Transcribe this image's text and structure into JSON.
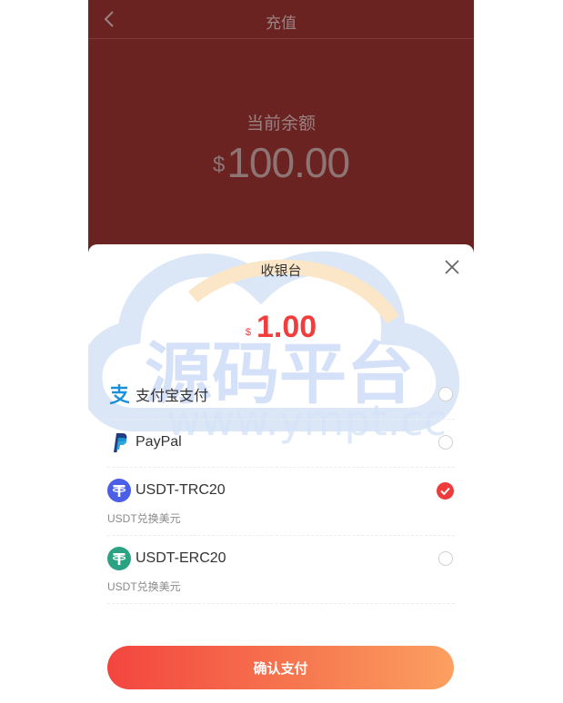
{
  "header": {
    "title": "充值",
    "back_icon": "chevron-left-icon"
  },
  "balance": {
    "label": "当前余额",
    "currency": "$",
    "amount": "100.00"
  },
  "cashier": {
    "title": "收银台",
    "close_icon": "close-icon",
    "currency": "$",
    "amount": "1.00",
    "methods": [
      {
        "label": "支付宝支付",
        "sub": "",
        "icon": "alipay-icon",
        "selected": false
      },
      {
        "label": "PayPal",
        "sub": "",
        "icon": "paypal-icon",
        "selected": false
      },
      {
        "label": "USDT-TRC20",
        "sub": "USDT兑换美元",
        "icon": "tether-icon",
        "selected": true
      },
      {
        "label": "USDT-ERC20",
        "sub": "USDT兑换美元",
        "icon": "tether-icon",
        "selected": false
      }
    ],
    "confirm_label": "确认支付"
  },
  "watermark": {
    "title": "源码平台",
    "url": "www.ympt.cc"
  },
  "colors": {
    "header_bg": "#6b2322",
    "accent": "#ee3b3b",
    "button_gradient_start": "#f3453f",
    "button_gradient_end": "#fca061",
    "tether_trc": "#4a5ee8",
    "tether_erc": "#2aa283",
    "alipay": "#1a8fdc",
    "paypal_dark": "#253b80",
    "paypal_light": "#179bd7"
  }
}
